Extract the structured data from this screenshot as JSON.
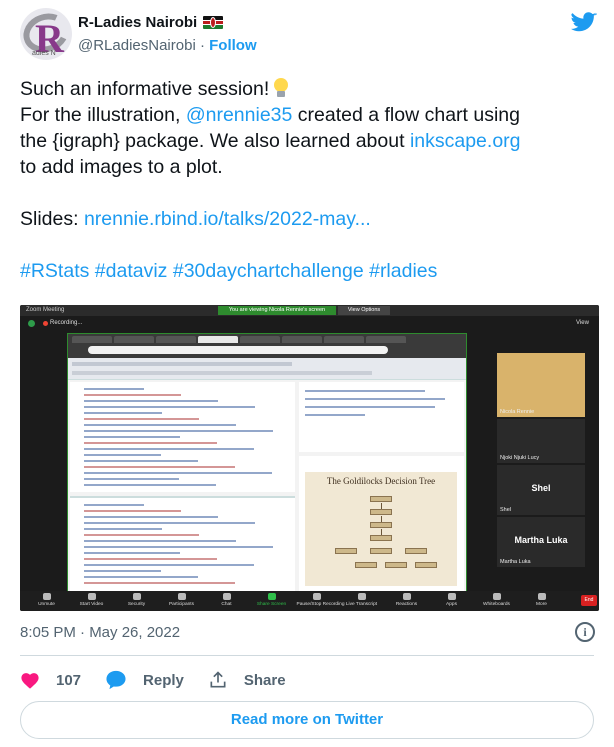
{
  "author": {
    "name": "R-Ladies Nairobi",
    "handle": "@RLadiesNairobi",
    "separator": "·",
    "follow_label": "Follow",
    "avatar_letter": "R",
    "avatar_caption": "adies N"
  },
  "tweet": {
    "line1": "Such an informative session!",
    "line2_pre": "For the illustration, ",
    "line2_link": "@nrennie35",
    "line2_post": " created a flow chart using",
    "line3_pre": "the {igraph} package. We also learned about ",
    "line3_link": "inkscape.org",
    "line4": "to add images to a plot.",
    "slides_pre": "Slides: ",
    "slides_link": "nrennie.rbind.io/talks/2022-may...",
    "hashtags": [
      "#RStats",
      "#dataviz",
      "#30daychartchallenge",
      "#rladies"
    ]
  },
  "media": {
    "zoom_title": "Zoom Meeting",
    "viewing_banner": "You are viewing Nicola Rennie's screen",
    "view_options": "View Options",
    "recording": "Recording...",
    "view": "View",
    "plot_title": "The Goldilocks Decision Tree",
    "participants": [
      {
        "name": "Nicola Rennie",
        "big": ""
      },
      {
        "name": "Njoki Njuki Lucy",
        "big": ""
      },
      {
        "name": "Shel",
        "big": "Shel"
      },
      {
        "name": "Martha Luka",
        "big": "Martha Luka"
      }
    ],
    "toolbar": [
      {
        "label": "Unmute",
        "active": false
      },
      {
        "label": "Start Video",
        "active": false
      },
      {
        "label": "Security",
        "active": false
      },
      {
        "label": "Participants",
        "active": false
      },
      {
        "label": "Chat",
        "active": false
      },
      {
        "label": "Share Screen",
        "active": true
      },
      {
        "label": "Pause/Stop Recording",
        "active": false
      },
      {
        "label": "Live Transcript",
        "active": false
      },
      {
        "label": "Reactions",
        "active": false
      },
      {
        "label": "Apps",
        "active": false
      },
      {
        "label": "Whiteboards",
        "active": false
      },
      {
        "label": "More",
        "active": false
      }
    ],
    "end_label": "End"
  },
  "footer": {
    "timestamp": "8:05 PM · May 26, 2022",
    "like_count": "107",
    "reply_label": "Reply",
    "share_label": "Share",
    "read_more_label": "Read more on Twitter"
  },
  "colors": {
    "link": "#1d9bf0",
    "like": "#f91880",
    "text": "#0f1419",
    "muted": "#536471"
  }
}
